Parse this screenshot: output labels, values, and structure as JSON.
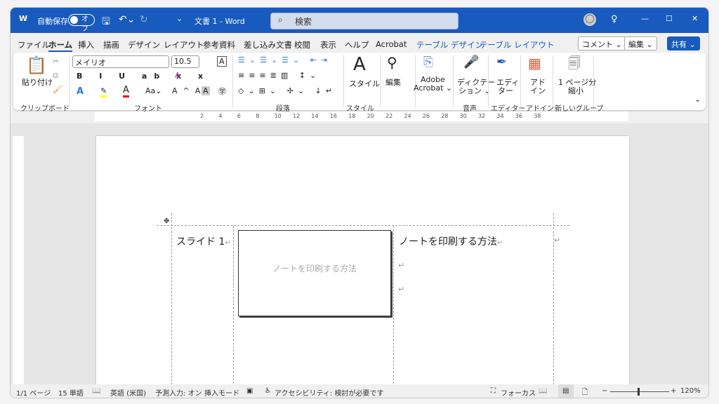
{
  "title": {
    "autosave": "自動保存",
    "toggle": "オフ",
    "doc": "文書 1  -  Word",
    "search": "検索"
  },
  "tabs": [
    "ファイル",
    "ホーム",
    "挿入",
    "描画",
    "デザイン",
    "レイアウト",
    "参考資料",
    "差し込み文書",
    "校閲",
    "表示",
    "ヘルプ",
    "Acrobat",
    "テーブル デザイン",
    "テーブル レイアウト"
  ],
  "header_buttons": {
    "comment": "コメント ⌄",
    "edit": "編集 ⌄",
    "share": "共有 ⌄"
  },
  "ribbon": {
    "paste": "貼り付け",
    "font": "メイリオ",
    "size": "10.5",
    "styles": "スタイル",
    "edit": "編集",
    "adobe1": "Adobe",
    "adobe2": "Acrobat ⌄",
    "dict1": "ディクテー",
    "dict2": "ション ⌄",
    "editor1": "エディ",
    "editor2": "ター",
    "addin1": "アド",
    "addin2": "イン",
    "shrink1": "1 ページ分",
    "shrink2": "縮小",
    "groups": {
      "clipboard": "クリップボード",
      "font": "フォント",
      "paragraph": "段落",
      "style": "スタイル",
      "voice": "音声",
      "editor": "エディター",
      "addin": "アドイン",
      "newgroup": "新しいグループ"
    }
  },
  "ruler": [
    2,
    4,
    6,
    8,
    10,
    12,
    14,
    16,
    18,
    20,
    22,
    24,
    26,
    28,
    30,
    32,
    34,
    36,
    38
  ],
  "table": {
    "cell1": "スライド 1",
    "placeholder": "ノートを印刷する方法",
    "cell3": "ノートを印刷する方法"
  },
  "status": {
    "page": "1/1 ページ",
    "words": "15 単語",
    "lang": "英語 (米国)",
    "predict": "予測入力: オン",
    "insert": "挿入モード",
    "access": "アクセシビリティ: 検討が必要です",
    "focus": "フォーカス",
    "zoom": "120%"
  },
  "colors": {
    "brand": "#185abd"
  }
}
